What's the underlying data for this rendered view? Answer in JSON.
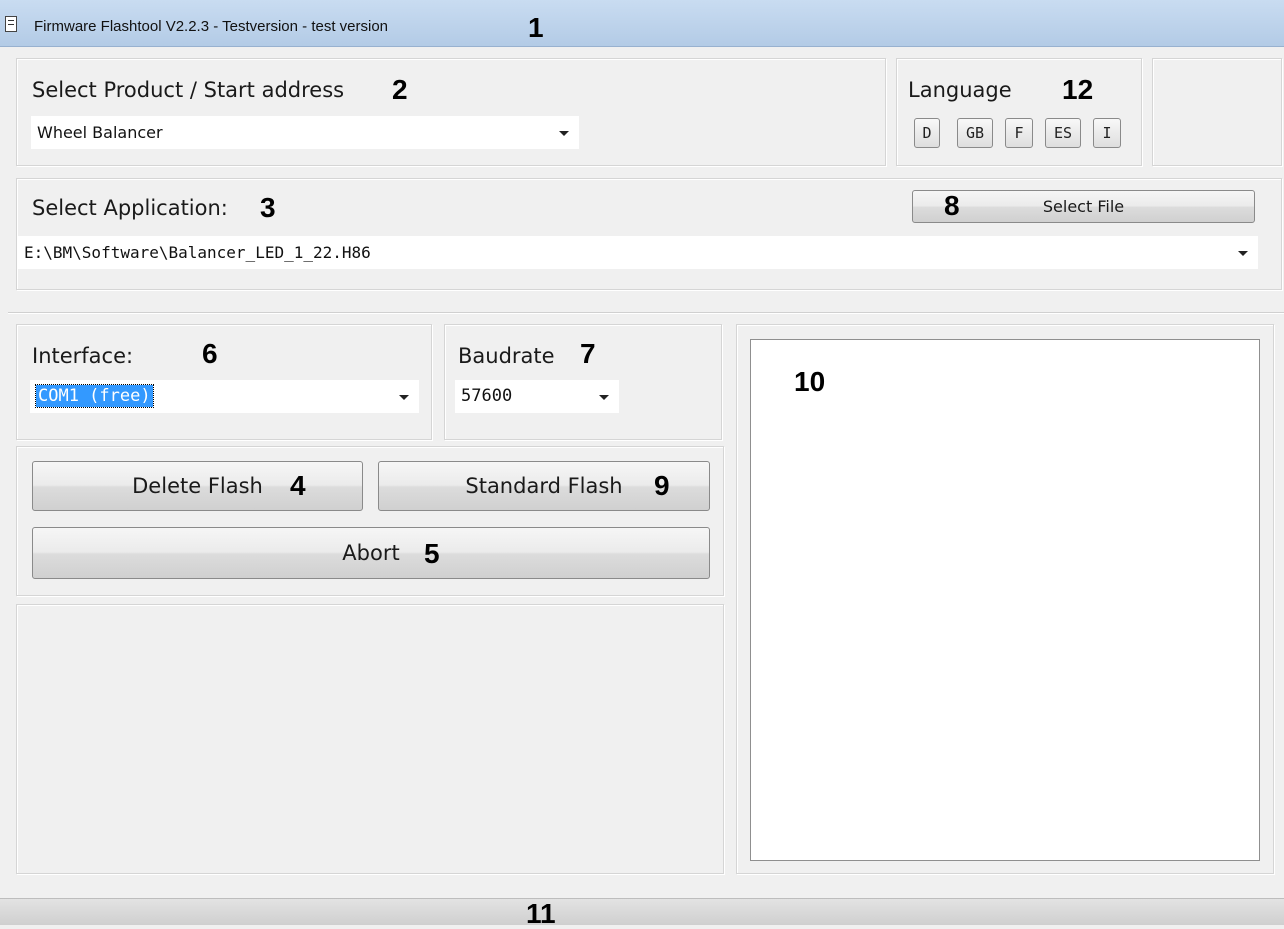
{
  "window": {
    "title": "Firmware Flashtool V2.2.3 - Testversion - test version"
  },
  "product": {
    "label": "Select Product / Start address",
    "selected": "Wheel Balancer"
  },
  "language": {
    "label": "Language",
    "buttons": [
      "D",
      "GB",
      "F",
      "ES",
      "I"
    ]
  },
  "application": {
    "label": "Select Application:",
    "selected_file": "E:\\BM\\Software\\Balancer_LED_1_22.H86",
    "select_file_label": "Select File"
  },
  "interface": {
    "label": "Interface:",
    "selected": "COM1 (free)"
  },
  "baudrate": {
    "label": "Baudrate",
    "selected": "57600"
  },
  "actions": {
    "delete_flash": "Delete Flash",
    "standard_flash": "Standard Flash",
    "abort": "Abort"
  },
  "callouts": {
    "n1": "1",
    "n2": "2",
    "n3": "3",
    "n4": "4",
    "n5": "5",
    "n6": "6",
    "n7": "7",
    "n8": "8",
    "n9": "9",
    "n10": "10",
    "n11": "11",
    "n12": "12"
  },
  "colors": {
    "titlebar": "#b3cbe6",
    "selection": "#3399ff",
    "background": "#f0f0f0"
  }
}
